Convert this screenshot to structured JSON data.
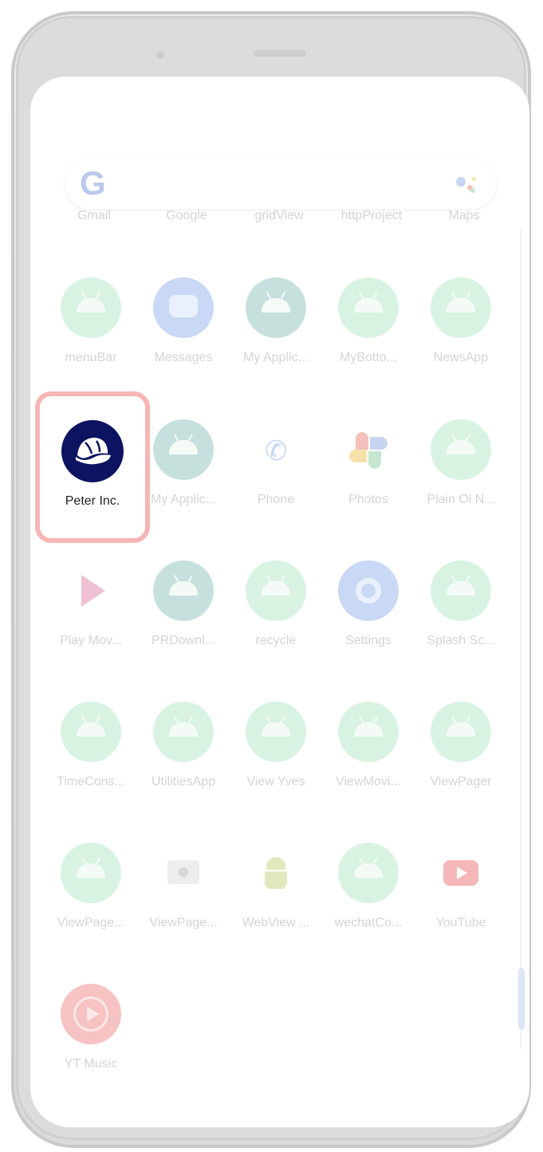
{
  "search_bar": {
    "logo_text": "G"
  },
  "top_row_labels": [
    "Gmail",
    "Google",
    "gridView",
    "httpProject",
    "Maps"
  ],
  "apps": [
    {
      "label": "menuBar",
      "icon": "android-icon"
    },
    {
      "label": "Messages",
      "icon": "messages-icon"
    },
    {
      "label": "My Applic...",
      "icon": "android-icon"
    },
    {
      "label": "MyBotto...",
      "icon": "android-icon"
    },
    {
      "label": "NewsApp",
      "icon": "android-icon"
    },
    {
      "label": "Peter Inc.",
      "icon": "cap-icon"
    },
    {
      "label": "My Applic...",
      "icon": "android-icon"
    },
    {
      "label": "Phone",
      "icon": "phone-icon"
    },
    {
      "label": "Photos",
      "icon": "photos-icon"
    },
    {
      "label": "Plain Ol N...",
      "icon": "android-icon"
    },
    {
      "label": "Play Mov...",
      "icon": "play-movies-icon"
    },
    {
      "label": "PRDownl...",
      "icon": "android-icon"
    },
    {
      "label": "recycle",
      "icon": "android-icon"
    },
    {
      "label": "Settings",
      "icon": "gear-icon"
    },
    {
      "label": "Splash Sc...",
      "icon": "android-icon"
    },
    {
      "label": "TimeCons...",
      "icon": "android-icon"
    },
    {
      "label": "UtilitiesApp",
      "icon": "android-icon"
    },
    {
      "label": "View Yves",
      "icon": "android-icon"
    },
    {
      "label": "ViewMovi...",
      "icon": "android-icon"
    },
    {
      "label": "ViewPager",
      "icon": "android-icon"
    },
    {
      "label": "ViewPage...",
      "icon": "android-icon"
    },
    {
      "label": "ViewPage...",
      "icon": "folder-icon"
    },
    {
      "label": "WebView ...",
      "icon": "android-robot-icon"
    },
    {
      "label": "wechatCo...",
      "icon": "android-icon"
    },
    {
      "label": "YouTube",
      "icon": "youtube-icon"
    },
    {
      "label": "YT Music",
      "icon": "yt-music-icon"
    }
  ],
  "highlighted_app": {
    "label": "Peter Inc.",
    "icon": "cap-icon",
    "accent": "#0c1361",
    "marker_color": "#e00000"
  }
}
